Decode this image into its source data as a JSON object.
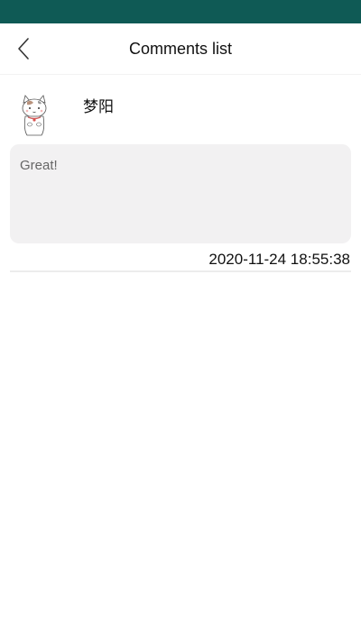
{
  "status_bar": {
    "color": "#0f5a55"
  },
  "header": {
    "title": "Comments list",
    "back_icon": "chevron-left-icon"
  },
  "comments": [
    {
      "avatar_icon": "cat-avatar",
      "username": "梦阳",
      "text": "Great!",
      "timestamp": "2020-11-24 18:55:38"
    }
  ]
}
